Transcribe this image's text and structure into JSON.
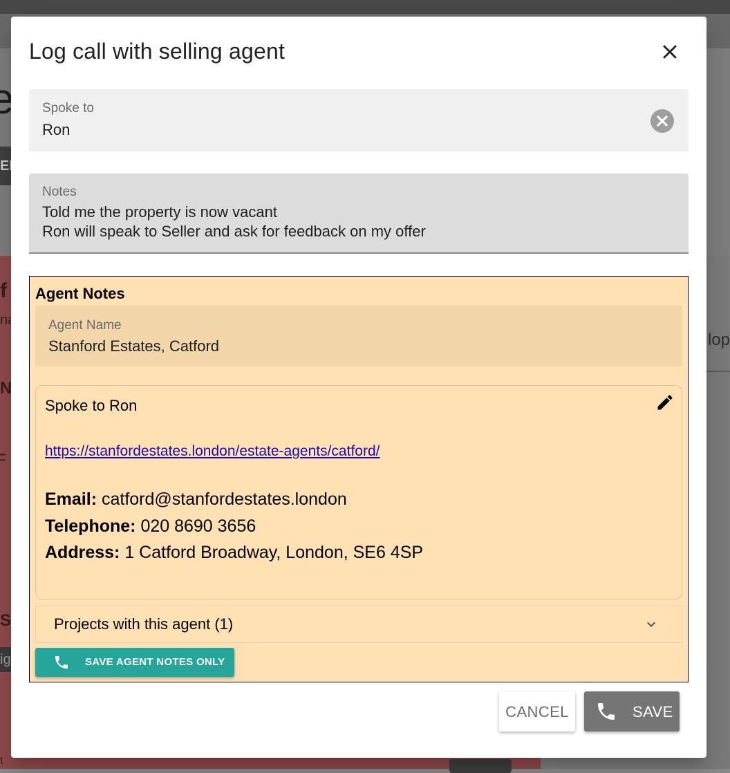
{
  "background": {
    "fragment_big": "e",
    "fragment_chip": "ED",
    "fragment_f": "f",
    "fragment_na": "na",
    "fragment_n": "N",
    "fragment_r": "F",
    "fragment_s": "S",
    "fragment_ig": "ig",
    "fragment_t": "t",
    "fragment_lop": "lop"
  },
  "dialog": {
    "title": "Log call with selling agent",
    "close_icon": "close-icon",
    "spoke_to": {
      "label": "Spoke to",
      "value": "Ron",
      "clear_icon": "clear-circle-icon"
    },
    "notes": {
      "label": "Notes",
      "value": "Told me the property is now vacant\nRon will speak to Seller and ask for feedback on my offer"
    },
    "agent_notes": {
      "title": "Agent Notes",
      "agent_name_label": "Agent Name",
      "agent_name_value": "Stanford Estates, Catford",
      "card": {
        "line1": "Spoke to Ron",
        "link": "https://stanfordestates.london/estate-agents/catford/",
        "email_label": "Email:",
        "email_value": "catford@stanfordestates.london",
        "phone_label": "Telephone:",
        "phone_value": "020 8690 3656",
        "address_label": "Address:",
        "address_value": "1 Catford Broadway, London, SE6 4SP",
        "edit_icon": "pencil-icon"
      },
      "projects_label": "Projects with this agent (1)",
      "projects_icon": "chevron-down-icon",
      "save_notes_label": "SAVE AGENT NOTES ONLY",
      "save_notes_icon": "phone-icon"
    },
    "cancel_label": "CANCEL",
    "save_label": "SAVE",
    "save_icon": "phone-icon"
  },
  "colors": {
    "agent_box": "#ffe1b3",
    "teal_button": "#26a69a",
    "save_button": "#757575",
    "link": "#1a0dab"
  }
}
